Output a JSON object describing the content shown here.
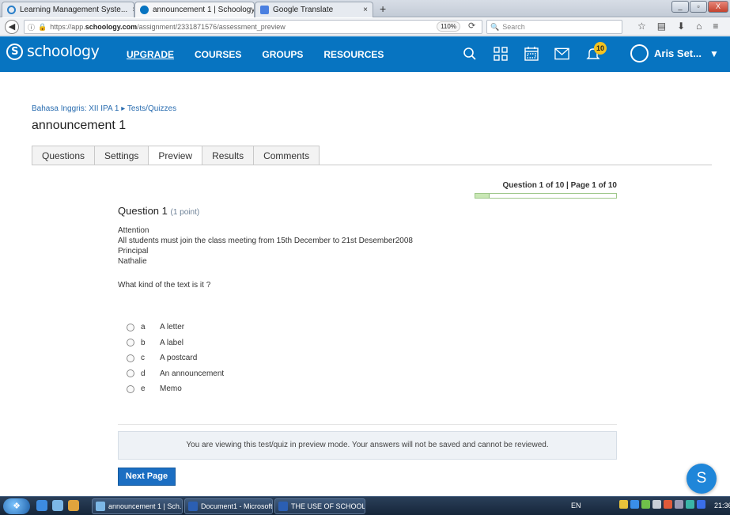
{
  "browser": {
    "tabs": [
      {
        "label": "Learning Management Syste...",
        "close": "×"
      },
      {
        "label": "announcement 1 | Schoology",
        "close": "×"
      },
      {
        "label": "Google Translate",
        "close": "×"
      }
    ],
    "new_tab": "+",
    "url_prefix": "https://app.",
    "url_domain": "schoology.com",
    "url_path": "/assignment/2331871576/assessment_preview",
    "zoom": "110%",
    "search_placeholder": "Search",
    "window_buttons": [
      "_",
      "▫",
      "X"
    ]
  },
  "header": {
    "logo": "schoology",
    "nav": [
      "UPGRADE",
      "COURSES",
      "GROUPS",
      "RESOURCES"
    ],
    "notification_count": "10",
    "user_name": "Aris Set...",
    "icons": [
      "search-icon",
      "apps-grid-icon",
      "calendar-icon",
      "mail-icon",
      "bell-icon",
      "avatar",
      "chevron-down-icon"
    ]
  },
  "page": {
    "breadcrumb": "Bahasa Inggris: XII IPA 1 ▸ Tests/Quizzes",
    "title": "announcement 1",
    "tabs": [
      "Questions",
      "Settings",
      "Preview",
      "Results",
      "Comments"
    ],
    "selected_tab": "Preview"
  },
  "quiz": {
    "position": "Question 1 of 10 | Page 1 of 10",
    "progress": 0.1,
    "question_label": "Question 1",
    "points": "(1 point)",
    "body": [
      "Attention",
      "All students must join the class meeting from 15th December to 21st Desember2008",
      "Principal",
      "Nathalie"
    ],
    "prompt": "What kind of the text is it ?",
    "choices": [
      {
        "letter": "a",
        "text": "A letter"
      },
      {
        "letter": "b",
        "text": "A label"
      },
      {
        "letter": "c",
        "text": "A postcard"
      },
      {
        "letter": "d",
        "text": "An announcement"
      },
      {
        "letter": "e",
        "text": "Memo"
      }
    ],
    "preview_notice": "You are viewing this test/quiz in preview mode. Your answers will not be saved and cannot be reviewed.",
    "next_button": "Next Page",
    "help_button": "S"
  },
  "taskbar": {
    "windows": [
      "announcement 1 | Sch...",
      "Document1 - Microsoft...",
      "THE USE OF SCHOOL..."
    ],
    "language": "EN",
    "clock": "21:36"
  },
  "colors": {
    "brand": "#0774c1",
    "link": "#2a6db0",
    "button": "#1b6ec2",
    "badge": "#f3c220",
    "progress": "#c9e7b5"
  }
}
